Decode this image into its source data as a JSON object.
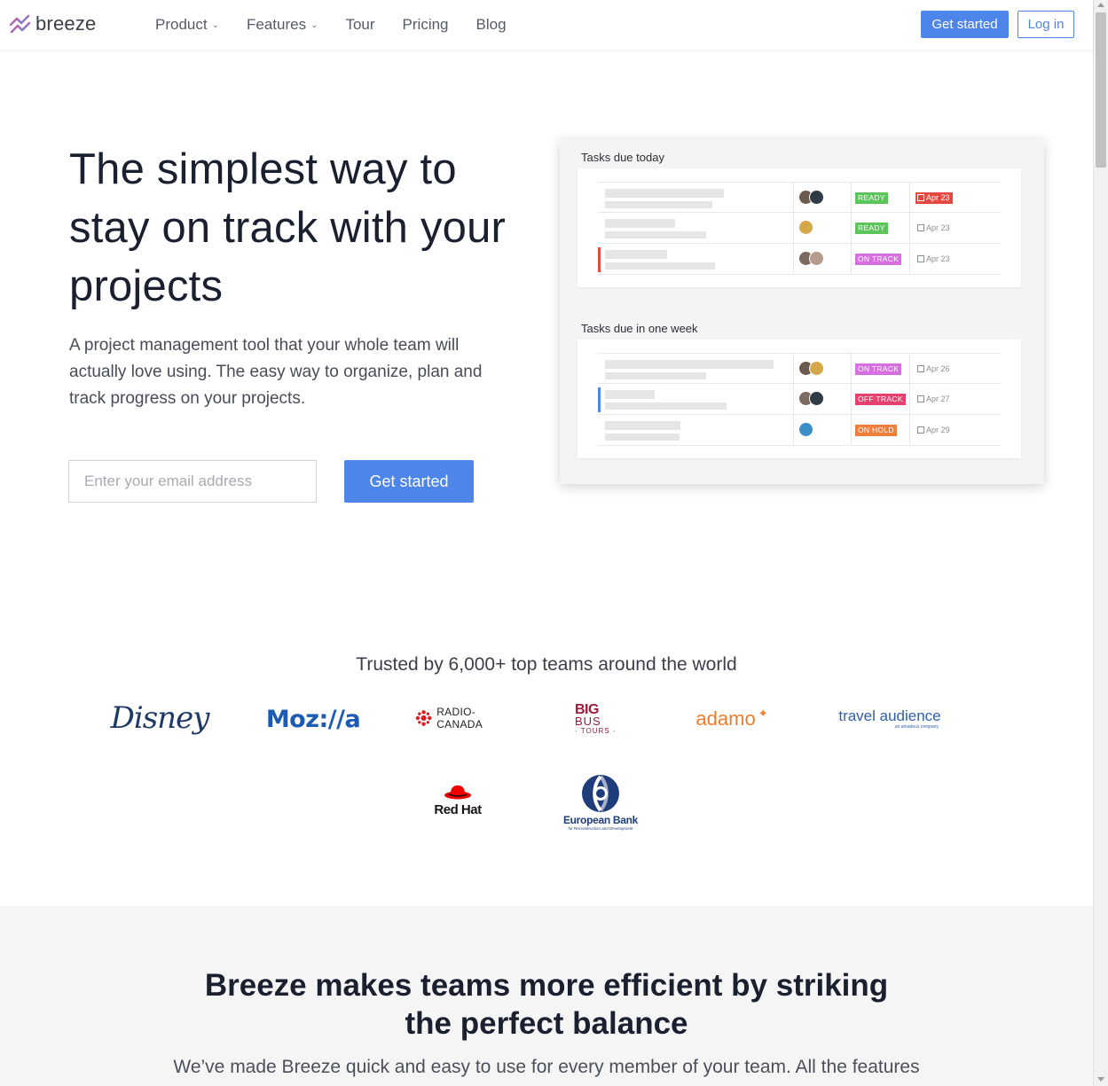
{
  "header": {
    "brand": "breeze",
    "nav": [
      {
        "label": "Product",
        "has_dropdown": true
      },
      {
        "label": "Features",
        "has_dropdown": true
      },
      {
        "label": "Tour",
        "has_dropdown": false
      },
      {
        "label": "Pricing",
        "has_dropdown": false
      },
      {
        "label": "Blog",
        "has_dropdown": false
      }
    ],
    "get_started_label": "Get started",
    "login_label": "Log in"
  },
  "hero": {
    "title": "The simplest way to stay on track with your projects",
    "subtitle": "A project management tool that your whole team will actually love using. The easy way to organize, plan and track progress on your projects.",
    "email_placeholder": "Enter your email address",
    "cta_label": "Get started"
  },
  "mockup": {
    "sections": [
      {
        "title": "Tasks due today",
        "rows": [
          {
            "status": "READY",
            "status_color": "#5cc55a",
            "due": "Apr 23",
            "overdue": true,
            "accent": null,
            "avatars": [
              "#6b5a4e",
              "#2f3a47"
            ]
          },
          {
            "status": "READY",
            "status_color": "#5cc55a",
            "due": "Apr 23",
            "overdue": false,
            "accent": null,
            "avatars": [
              "#d4a84a"
            ]
          },
          {
            "status": "ON TRACK",
            "status_color": "#d66fe0",
            "due": "Apr 23",
            "overdue": false,
            "accent": "#e5483f",
            "avatars": [
              "#7a6a60",
              "#b59b8c"
            ]
          }
        ]
      },
      {
        "title": "Tasks due in one week",
        "rows": [
          {
            "status": "ON TRACK",
            "status_color": "#d66fe0",
            "due": "Apr 26",
            "overdue": false,
            "accent": null,
            "avatars": [
              "#6b5a4e",
              "#d4a84a"
            ]
          },
          {
            "status": "OFF TRACK",
            "status_color": "#e6406e",
            "due": "Apr 27",
            "overdue": false,
            "accent": "#4e85e8",
            "avatars": [
              "#7a6a60",
              "#2f3a47"
            ]
          },
          {
            "status": "ON HOLD",
            "status_color": "#ef7d3c",
            "due": "Apr 29",
            "overdue": false,
            "accent": null,
            "avatars": [
              "#3b8fc6"
            ]
          }
        ]
      }
    ]
  },
  "trusted": {
    "heading": "Trusted by 6,000+ top teams around the world",
    "logos": {
      "disney": "Disney",
      "mozilla": "Moz://a",
      "radio_canada": "RADIO-CANADA",
      "bigbus_line1": "BIG",
      "bigbus_line2": "BUS",
      "bigbus_line3": "· TOURS ·",
      "adamo": "adamo",
      "travel_audience": "travel audience",
      "travel_audience_tag": "an amadeus company",
      "redhat": "Red Hat",
      "ebrd_line1": "European Bank",
      "ebrd_line2": "for Reconstruction and Development"
    }
  },
  "efficiency": {
    "title": "Breeze makes teams more efficient by striking the perfect balance",
    "subtitle": "We’ve made Breeze quick and easy to use for every member of your team. All the features"
  },
  "colors": {
    "accent": "#4e85e8",
    "logo_gradient_start": "#e94c8a",
    "logo_gradient_end": "#5a8ef0"
  },
  "icons": [
    "breeze-logo-icon",
    "chevron-down-icon",
    "calendar-icon"
  ]
}
